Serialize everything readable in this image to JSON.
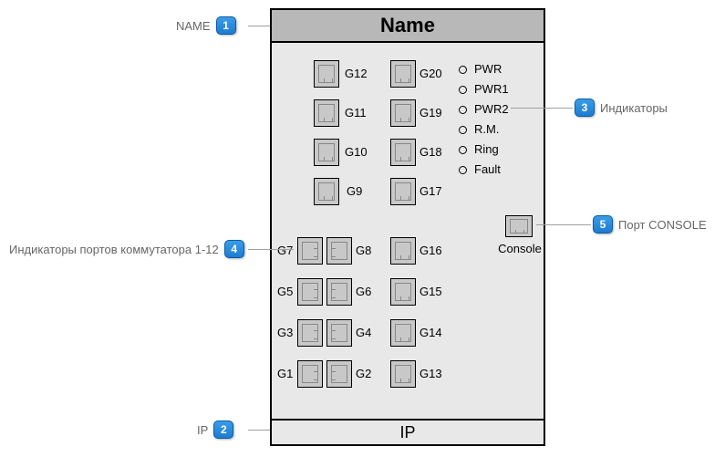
{
  "device": {
    "name": "Name",
    "ip": "IP"
  },
  "ports_upper_single": [
    {
      "label": "G12"
    },
    {
      "label": "G11"
    },
    {
      "label": "G10"
    },
    {
      "label": "G9"
    }
  ],
  "ports_upper_right": [
    {
      "label": "G20"
    },
    {
      "label": "G19"
    },
    {
      "label": "G18"
    },
    {
      "label": "G17"
    }
  ],
  "ports_lower_pairs": [
    {
      "left": "G7",
      "right": "G8"
    },
    {
      "left": "G5",
      "right": "G6"
    },
    {
      "left": "G3",
      "right": "G4"
    },
    {
      "left": "G1",
      "right": "G2"
    }
  ],
  "ports_lower_right": [
    {
      "label": "G16"
    },
    {
      "label": "G15"
    },
    {
      "label": "G14"
    },
    {
      "label": "G13"
    }
  ],
  "leds": [
    {
      "label": "PWR"
    },
    {
      "label": "PWR1"
    },
    {
      "label": "PWR2"
    },
    {
      "label": "R.M."
    },
    {
      "label": "Ring"
    },
    {
      "label": "Fault"
    }
  ],
  "console": {
    "label": "Console"
  },
  "callouts": [
    {
      "n": "1",
      "text": "NAME"
    },
    {
      "n": "2",
      "text": "IP"
    },
    {
      "n": "3",
      "text": "Индикаторы"
    },
    {
      "n": "4",
      "text": "Индикаторы портов коммутатора 1-12"
    },
    {
      "n": "5",
      "text": "Порт CONSOLE"
    }
  ]
}
